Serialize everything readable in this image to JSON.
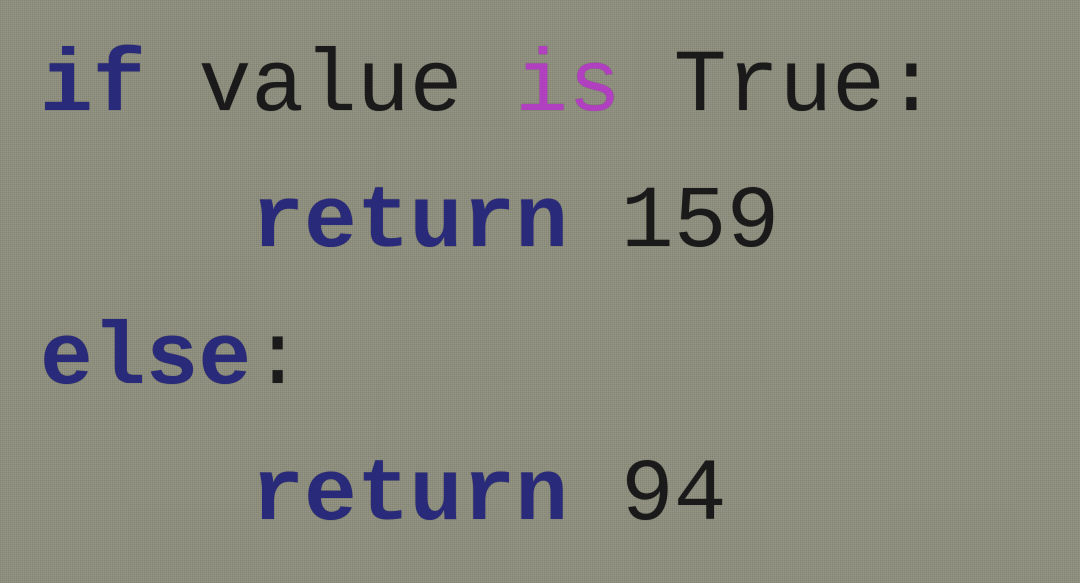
{
  "code": {
    "line1": {
      "kw_if": "if",
      "ident": "value",
      "op_is": "is",
      "const_true": "True",
      "colon": ":"
    },
    "line2": {
      "kw_return": "return",
      "number": "159"
    },
    "line3": {
      "kw_else": "else",
      "colon": ":"
    },
    "line4": {
      "kw_return": "return",
      "number": "94"
    }
  }
}
